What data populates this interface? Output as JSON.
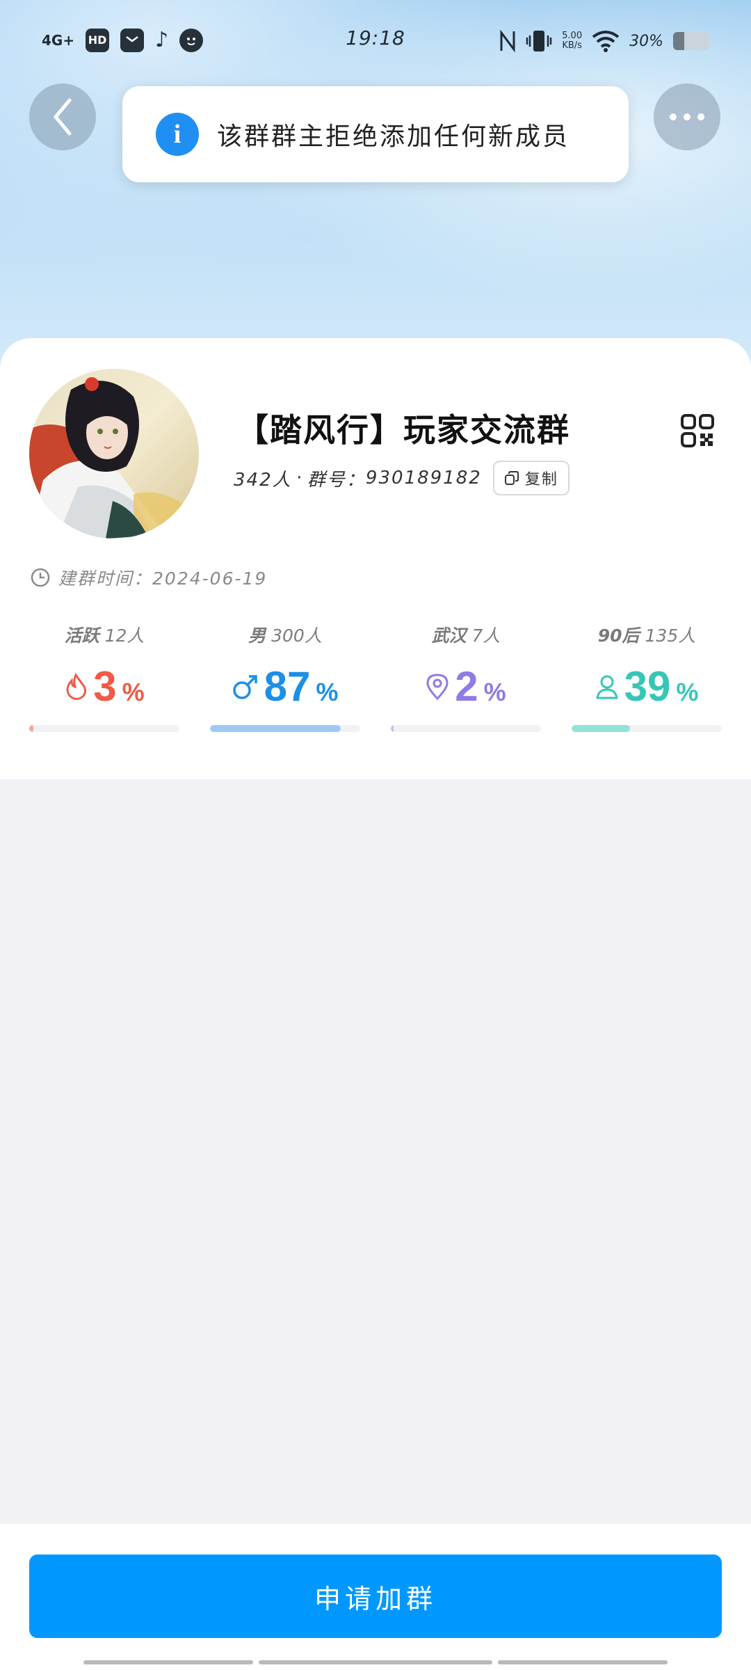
{
  "status_bar": {
    "network": "4G+",
    "app_icons": [
      "HD",
      "mail-icon",
      "tiktok-icon",
      "face-icon"
    ],
    "time": "19:18",
    "speed_value": "5.00",
    "speed_unit": "KB/s",
    "battery_percent": "30%",
    "battery_level": 0.3
  },
  "toast": {
    "message": "该群群主拒绝添加任何新成员"
  },
  "group": {
    "name": "【踏风行】玩家交流群",
    "member_count": "342人",
    "separator": "·",
    "group_number_label": "群号：",
    "group_number": "930189182",
    "copy_label": "复制",
    "created_label": "建群时间：",
    "created_date": "2024-06-19"
  },
  "stats": [
    {
      "label": "活跃",
      "count": "12人",
      "value": "3",
      "unit": "%",
      "level": 0.03,
      "color": "#f05a46",
      "bar_color": "#f5a69b",
      "icon": "flame-icon"
    },
    {
      "label": "男",
      "count": "300人",
      "value": "87",
      "unit": "%",
      "level": 0.87,
      "color": "#1c8fe6",
      "bar_color": "#9ec9f7",
      "icon": "male-icon"
    },
    {
      "label": "武汉",
      "count": "7人",
      "value": "2",
      "unit": "%",
      "level": 0.02,
      "color": "#8f7ae6",
      "bar_color": "#c6bbf2",
      "icon": "location-pin-icon"
    },
    {
      "label": "90后",
      "count": "135人",
      "value": "39",
      "unit": "%",
      "level": 0.39,
      "color": "#37c6b5",
      "bar_color": "#93e2d7",
      "icon": "person-icon"
    }
  ],
  "bottom": {
    "join_label": "申请加群"
  }
}
